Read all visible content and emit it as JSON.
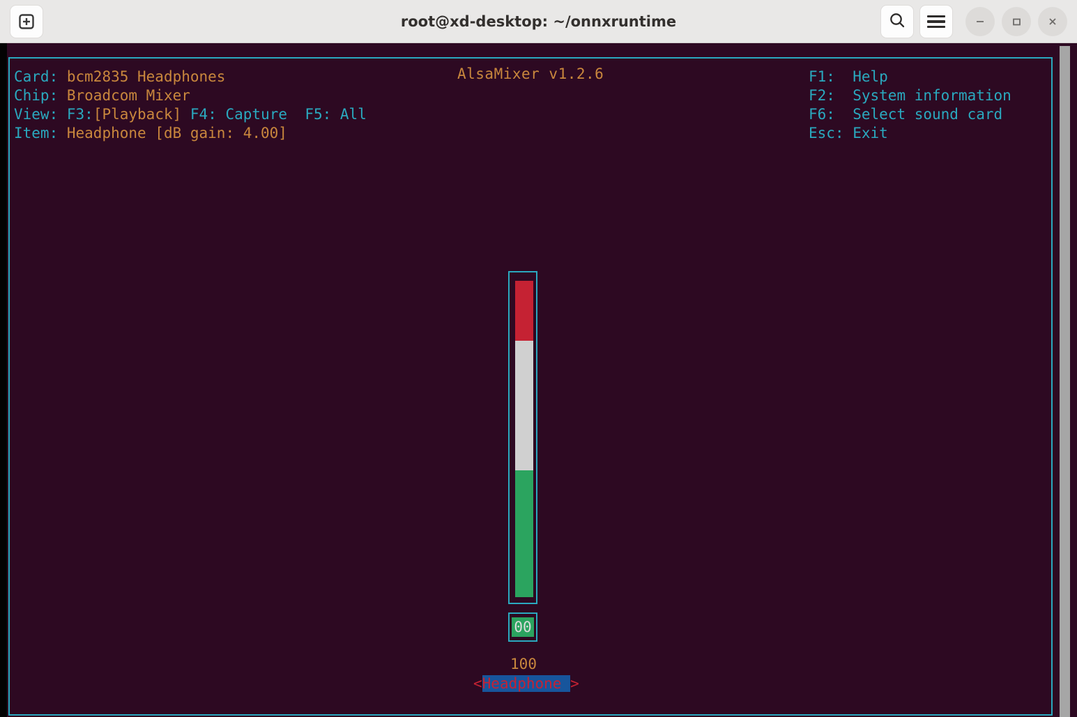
{
  "window": {
    "title": "root@xd-desktop: ~/onnxruntime",
    "newtab_icon": "new-tab-plus-icon",
    "search_icon": "search-icon",
    "menu_icon": "hamburger-menu-icon",
    "minimize_icon": "minimize-icon",
    "maximize_icon": "maximize-icon",
    "close_icon": "close-icon"
  },
  "mixer": {
    "frame_title": "AlsaMixer v1.2.6",
    "info": [
      {
        "label": "Card:",
        "value": "bcm2835 Headphones"
      },
      {
        "label": "Chip:",
        "value": "Broadcom Mixer"
      },
      {
        "label": "View:",
        "value": "F3:[Playback] F4: Capture  F5: All"
      },
      {
        "label": "Item:",
        "value": "Headphone [dB gain: 4.00]"
      }
    ],
    "view_parts": {
      "f3_key": "F3:",
      "f3_state": "[Playback]",
      "f4_key": "F4:",
      "f4_label": "Capture",
      "f5_key": "F5:",
      "f5_label": "All"
    },
    "help": [
      {
        "key": "F1:",
        "action": "Help"
      },
      {
        "key": "F2:",
        "action": "System information"
      },
      {
        "key": "F6:",
        "action": "Select sound card"
      },
      {
        "key": "Esc:",
        "action": "Exit"
      }
    ],
    "channel": {
      "name": "Headphone",
      "left_arrow": "<",
      "right_arrow": ">",
      "volume_value": "00",
      "max_label": "100",
      "bar_segments": [
        {
          "name": "red-zone",
          "color": "#c52233",
          "percent": 19
        },
        {
          "name": "grey-zone",
          "color": "#d0d0d0",
          "percent": 41
        },
        {
          "name": "green-zone",
          "color": "#2ba45f",
          "percent": 40
        }
      ]
    }
  },
  "colors": {
    "terminal_bg": "#2d0922",
    "frame_border": "#2aa9bf",
    "label_cyan": "#2aa9bf",
    "value_orange": "#c9873d",
    "select_blue": "#17559c",
    "select_red": "#c52233",
    "titlebar_bg": "#e9e8e7"
  }
}
